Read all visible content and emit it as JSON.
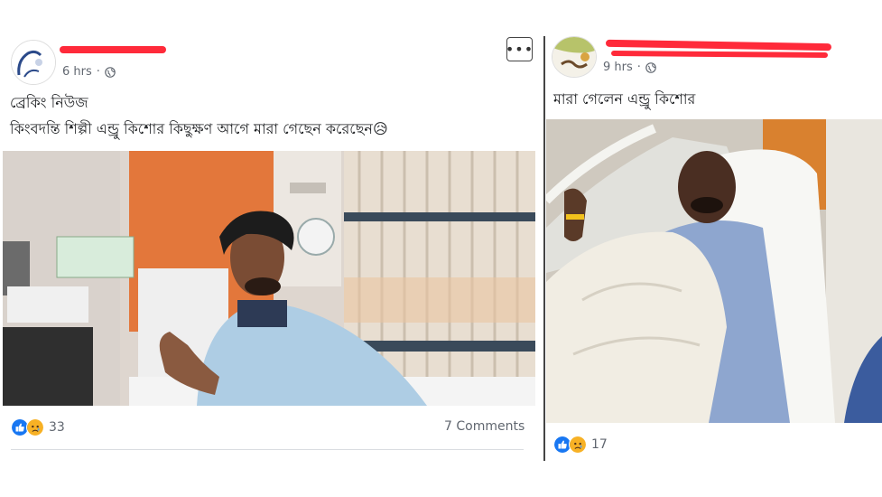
{
  "posts": [
    {
      "time": "6 hrs",
      "menu_label": "•••",
      "text_lines": [
        "ব্রেকিং নিউজ",
        "কিংবদন্তি শিল্পী এন্ড্রু কিশোর কিছুক্ষণ আগে মারা গেছেন করেছেন😥"
      ],
      "reaction_count": "33",
      "comments": "7 Comments"
    },
    {
      "time": "9 hrs",
      "text_lines": [
        "মারা গেলেন এন্ড্রু কিশোর"
      ],
      "reaction_count": "17"
    }
  ],
  "icons": {
    "privacy": "globe-icon",
    "reactions": [
      "like-reaction-icon",
      "sad-reaction-icon"
    ],
    "menu": "more-options-icon"
  },
  "colors": {
    "redaction": "#ff2a3a",
    "like_blue": "#1877f2",
    "sad_yellow": "#f7b125",
    "meta_gray": "#616770"
  }
}
